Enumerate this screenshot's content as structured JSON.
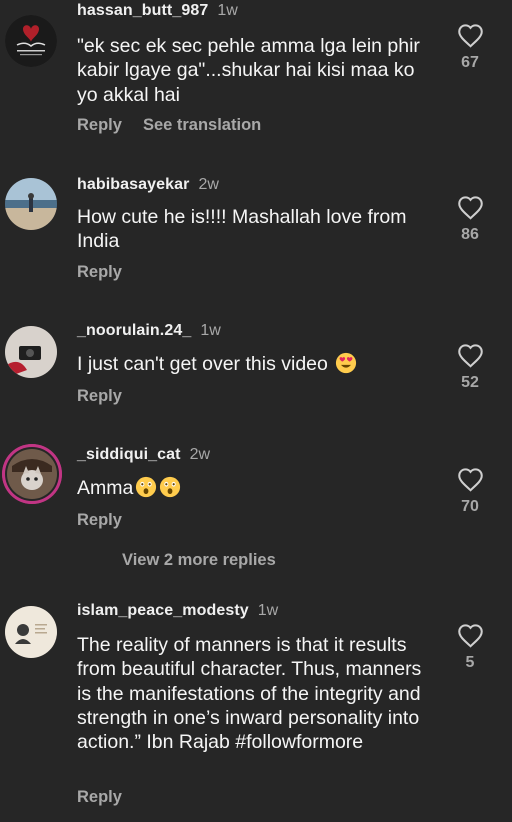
{
  "comments": [
    {
      "username": "hassan_butt_987",
      "time": "1w",
      "text": "\"ek sec ek sec pehle amma lga lein phir kabir lgaye ga\"...shukar hai kisi maa ko yo akkal hai",
      "reply_label": "Reply",
      "translate_label": "See translation",
      "likes": "67",
      "avatar_icon": "calligraphy-logo-avatar"
    },
    {
      "username": "habibasayekar",
      "time": "2w",
      "text": "How cute he is!!!! Mashallah love from India",
      "reply_label": "Reply",
      "likes": "86",
      "avatar_icon": "beach-photo-avatar"
    },
    {
      "username": "_noorulain.24_",
      "time": "1w",
      "text": "I just can't get over this video",
      "emoji": "heart-eyes-emoji",
      "reply_label": "Reply",
      "likes": "52",
      "avatar_icon": "camera-photo-avatar"
    },
    {
      "username": "_siddiqui_cat",
      "time": "2w",
      "text": "Amma",
      "emoji": "astonished-face-emoji",
      "reply_label": "Reply",
      "likes": "70",
      "avatar_icon": "cat-photo-avatar",
      "story_ring_color": "#c13584"
    },
    {
      "username": "islam_peace_modesty",
      "time": "1w",
      "text": "The reality of manners is that it results from beautiful character. Thus, manners is the manifestations of the integrity and strength in one’s inward personality into action.” Ibn Rajab #followformore",
      "reply_label": "Reply",
      "likes": "5",
      "avatar_icon": "quote-card-avatar"
    }
  ],
  "view_more_replies": "View 2 more replies",
  "colors": {
    "background": "#262626",
    "text": "#f5f5f5",
    "secondary": "#a8a8a8"
  },
  "icons": {
    "like": "heart-outline-icon"
  }
}
